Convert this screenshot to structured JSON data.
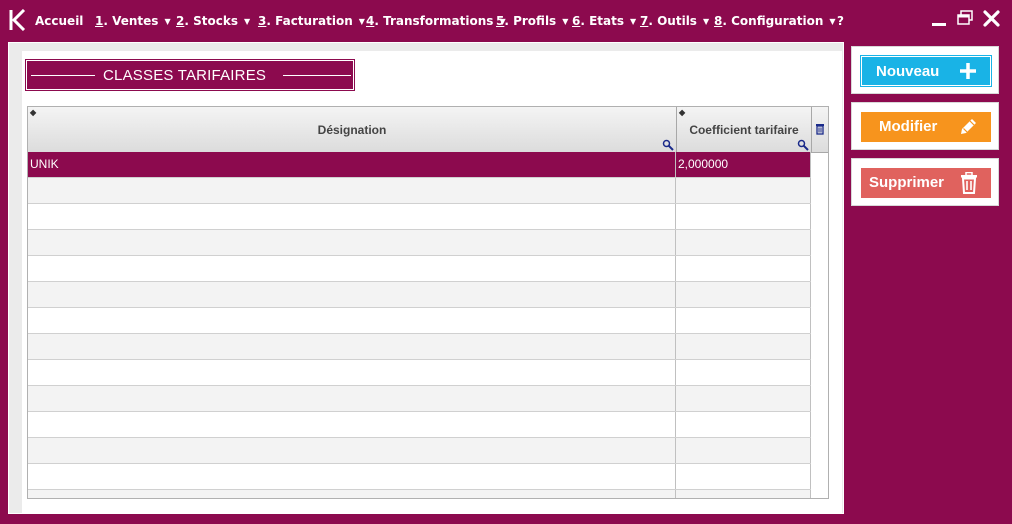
{
  "menu": {
    "home_label": "Accueil",
    "items": [
      {
        "num": "1",
        "label": ". Ventes"
      },
      {
        "num": "2",
        "label": ". Stocks"
      },
      {
        "num": "3",
        "label": ". Facturation"
      },
      {
        "num": "4",
        "label": ". Transformations"
      },
      {
        "num": "5",
        "label": ". Profils"
      },
      {
        "num": "6",
        "label": ". Etats"
      },
      {
        "num": "7",
        "label": ". Outils"
      },
      {
        "num": "8",
        "label": ". Configuration"
      }
    ],
    "help_label": "?"
  },
  "page": {
    "title": "CLASSES TARIFAIRES"
  },
  "table": {
    "columns": [
      "Désignation",
      "Coefficient tarifaire"
    ],
    "rows": [
      {
        "designation": "UNIK",
        "coefficient": "2,000000"
      }
    ]
  },
  "actions": {
    "new_label": "Nouveau",
    "edit_label": "Modifier",
    "delete_label": "Supprimer"
  },
  "icons": {
    "logo": "k-logo-icon",
    "minimize": "minimize-icon",
    "restore": "restore-icon",
    "close": "close-icon",
    "add": "plus-icon",
    "edit": "pencil-icon",
    "delete": "trash-icon"
  },
  "colors": {
    "brand": "#8c0a4e",
    "new": "#19b3e6",
    "edit": "#f7941d",
    "delete": "#e0625e"
  }
}
